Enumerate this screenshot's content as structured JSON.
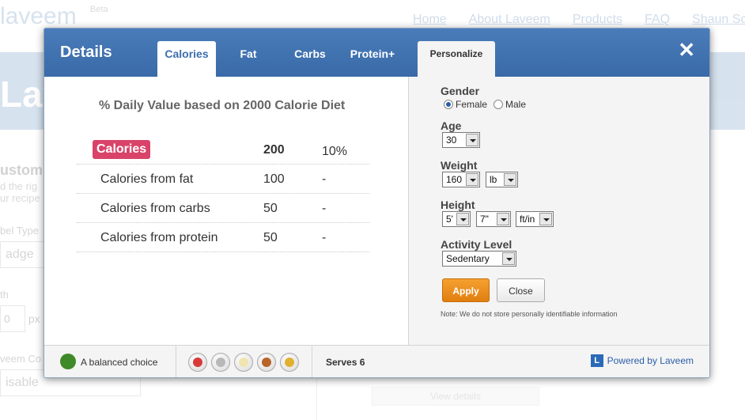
{
  "background": {
    "logo": "laveem",
    "beta": "Beta",
    "nav": [
      "Home",
      "About Laveem",
      "Products",
      "FAQ",
      "Shaun Sc"
    ],
    "hero": "Lave",
    "side_title": "ustomi",
    "side_desc_1": "d the rig",
    "side_desc_2": "ur recipe",
    "label_type": "bel Type",
    "type_value": "adge",
    "label_width": "th",
    "width_value": "0",
    "px_unit": "px",
    "label_color": "veem Co",
    "color_value": "isable",
    "view_details": "View details"
  },
  "modal": {
    "title": "Details",
    "tabs": [
      {
        "label": "Calories",
        "active": true
      },
      {
        "label": "Fat",
        "active": false
      },
      {
        "label": "Carbs",
        "active": false
      },
      {
        "label": "Protein+",
        "active": false
      }
    ],
    "personalize_tab": "Personalize",
    "close_glyph": "✕"
  },
  "nutrition": {
    "heading": "% Daily Value based on 2000 Calorie Diet",
    "rows": [
      {
        "name": "Calories",
        "amount": "200",
        "percent": "10%"
      },
      {
        "name": "Calories from fat",
        "amount": "100",
        "percent": "-"
      },
      {
        "name": "Calories from carbs",
        "amount": "50",
        "percent": "-"
      },
      {
        "name": "Calories from protein",
        "amount": "50",
        "percent": "-"
      }
    ]
  },
  "personalize": {
    "gender_label": "Gender",
    "female": "Female",
    "male": "Male",
    "gender_selected": "Female",
    "age_label": "Age",
    "age_value": "30",
    "weight_label": "Weight",
    "weight_value": "160",
    "weight_unit": "lb",
    "height_label": "Height",
    "height_feet": "5'",
    "height_inches": "7\"",
    "height_unit": "ft/in",
    "activity_label": "Activity Level",
    "activity_value": "Sedentary",
    "apply": "Apply",
    "close": "Close",
    "note": "Note: We do not store personally identifiable information"
  },
  "footer": {
    "balanced": "A balanced choice",
    "balanced_color": "#3f8a28",
    "food_groups": [
      {
        "icon": "fruit-icon",
        "color": "#d83a3a"
      },
      {
        "icon": "dairy-icon",
        "color": "#b8b8b8"
      },
      {
        "icon": "egg-icon",
        "color": "#f0e4b0"
      },
      {
        "icon": "meat-icon",
        "color": "#b8642a"
      },
      {
        "icon": "grain-icon",
        "color": "#e0b030"
      }
    ],
    "serves": "Serves 6",
    "powered_badge": "L",
    "powered": "Powered by Laveem"
  }
}
